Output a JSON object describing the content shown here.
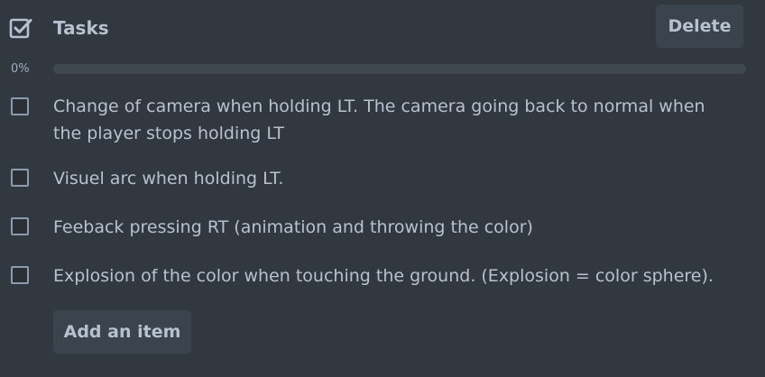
{
  "header": {
    "title": "Tasks",
    "icon": "checklist-icon",
    "delete_label": "Delete"
  },
  "progress": {
    "label": "0%",
    "fraction": 0
  },
  "items": [
    {
      "line1": "Change of camera when holding LT. The camera going back to normal when",
      "line2": "the player stops holding LT",
      "checked": false
    },
    {
      "text": "Visuel arc when holding LT.",
      "checked": false
    },
    {
      "text": "Feeback pressing RT (animation and throwing the color)",
      "checked": false
    },
    {
      "text": "Explosion of the color when touching the ground. (Explosion = color sphere).",
      "checked": false
    }
  ],
  "add_item_label": "Add an item",
  "colors": {
    "background": "#323840",
    "text": "#b6c2cf",
    "button": "#3b434c",
    "track": "#3f474f",
    "checkbox_border": "#8c9bab"
  }
}
